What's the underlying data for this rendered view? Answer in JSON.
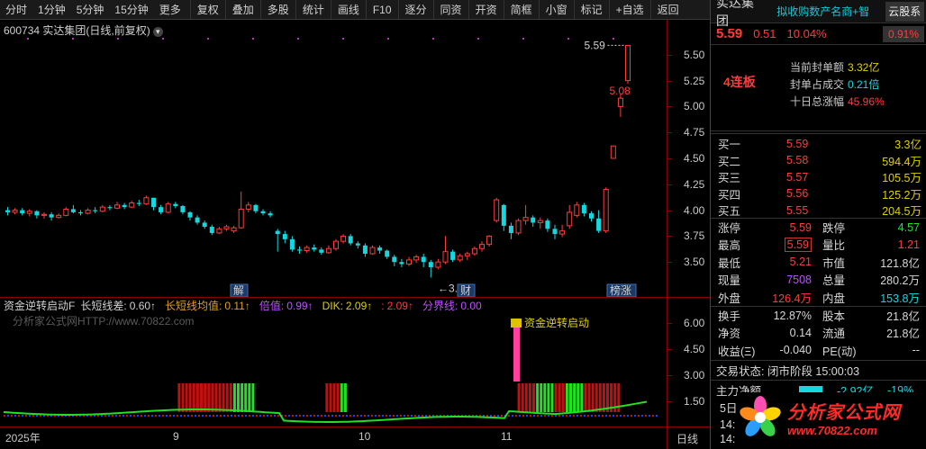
{
  "toolbar": {
    "periods": [
      "分时",
      "1分钟",
      "5分钟",
      "15分钟",
      "更多"
    ],
    "buttons": [
      "复权",
      "叠加",
      "多股",
      "统计",
      "画线",
      "F10",
      "逐分",
      "同资",
      "开资",
      "简框",
      "小窗",
      "标记",
      "+自选",
      "返回"
    ]
  },
  "chart": {
    "header": "600734 实达集团(日线,前复权)",
    "high_label": "5.59",
    "close_label": "5.08",
    "low_label": "←3.35",
    "marker_jie": "解",
    "marker_cai": "财",
    "marker_bangzhang": "榜涨",
    "price_ticks": [
      "5.50",
      "5.25",
      "5.00",
      "4.75",
      "4.50",
      "4.25",
      "4.00",
      "3.75",
      "3.50"
    ],
    "colors": {
      "up": "#ff3c3c",
      "down": "#14d8e0",
      "axis": "#8a0000"
    }
  },
  "chart_data": {
    "type": "candlestick",
    "ylim": [
      3.35,
      5.65
    ],
    "candles": [
      [
        4.0,
        3.98,
        4.03,
        3.95
      ],
      [
        3.98,
        4.0,
        4.02,
        3.96
      ],
      [
        4.0,
        3.97,
        4.02,
        3.95
      ],
      [
        3.97,
        3.99,
        4.01,
        3.94
      ],
      [
        3.99,
        3.95,
        4.0,
        3.92
      ],
      [
        3.95,
        3.96,
        3.98,
        3.92
      ],
      [
        3.96,
        3.93,
        3.98,
        3.9
      ],
      [
        3.93,
        3.95,
        3.97,
        3.92
      ],
      [
        3.95,
        4.01,
        4.03,
        3.94
      ],
      [
        4.01,
        3.98,
        4.05,
        3.97
      ],
      [
        3.98,
        3.97,
        4.0,
        3.95
      ],
      [
        3.97,
        4.0,
        4.02,
        3.96
      ],
      [
        4.0,
        3.99,
        4.03,
        3.97
      ],
      [
        3.99,
        4.03,
        4.05,
        3.98
      ],
      [
        4.03,
        4.02,
        4.05,
        4.0
      ],
      [
        4.02,
        4.05,
        4.08,
        4.01
      ],
      [
        4.05,
        4.03,
        4.07,
        4.01
      ],
      [
        4.03,
        4.07,
        4.09,
        4.02
      ],
      [
        4.07,
        4.06,
        4.1,
        4.04
      ],
      [
        4.06,
        4.12,
        4.14,
        4.05
      ],
      [
        4.12,
        4.03,
        4.12,
        4.0
      ],
      [
        4.03,
        3.98,
        4.05,
        3.96
      ],
      [
        3.98,
        4.06,
        4.08,
        3.97
      ],
      [
        4.06,
        4.04,
        4.08,
        4.02
      ],
      [
        4.04,
        3.98,
        4.05,
        3.96
      ],
      [
        3.98,
        3.93,
        3.99,
        3.9
      ],
      [
        3.93,
        3.88,
        3.95,
        3.86
      ],
      [
        3.88,
        3.84,
        3.9,
        3.82
      ],
      [
        3.84,
        3.78,
        3.86,
        3.76
      ],
      [
        3.78,
        3.82,
        3.84,
        3.77
      ],
      [
        3.82,
        3.84,
        3.86,
        3.8
      ],
      [
        3.8,
        3.83,
        3.85,
        3.78
      ],
      [
        3.83,
        4.01,
        4.18,
        3.82
      ],
      [
        4.01,
        4.05,
        4.08,
        3.98
      ],
      [
        4.05,
        3.99,
        4.06,
        3.97
      ],
      [
        3.99,
        3.97,
        4.01,
        3.95
      ],
      [
        3.97,
        3.95,
        3.99,
        3.93
      ],
      [
        3.8,
        3.77,
        3.82,
        3.6
      ],
      [
        3.77,
        3.72,
        3.8,
        3.68
      ],
      [
        3.72,
        3.62,
        3.75,
        3.6
      ],
      [
        3.62,
        3.61,
        3.65,
        3.58
      ],
      [
        3.61,
        3.64,
        3.66,
        3.59
      ],
      [
        3.64,
        3.62,
        3.67,
        3.6
      ],
      [
        3.62,
        3.59,
        3.64,
        3.57
      ],
      [
        3.59,
        3.63,
        3.66,
        3.58
      ],
      [
        3.63,
        3.7,
        3.72,
        3.61
      ],
      [
        3.7,
        3.75,
        3.77,
        3.68
      ],
      [
        3.75,
        3.68,
        3.77,
        3.66
      ],
      [
        3.68,
        3.66,
        3.7,
        3.63
      ],
      [
        3.66,
        3.58,
        3.68,
        3.55
      ],
      [
        3.58,
        3.64,
        3.66,
        3.57
      ],
      [
        3.64,
        3.61,
        3.66,
        3.58
      ],
      [
        3.61,
        3.55,
        3.62,
        3.53
      ],
      [
        3.55,
        3.5,
        3.57,
        3.46
      ],
      [
        3.5,
        3.48,
        3.53,
        3.45
      ],
      [
        3.48,
        3.52,
        3.55,
        3.46
      ],
      [
        3.52,
        3.55,
        3.57,
        3.49
      ],
      [
        3.55,
        3.5,
        3.58,
        3.45
      ],
      [
        3.5,
        3.45,
        3.52,
        3.35
      ],
      [
        3.45,
        3.5,
        3.53,
        3.43
      ],
      [
        3.5,
        3.6,
        3.75,
        3.48
      ],
      [
        3.6,
        3.52,
        3.62,
        3.5
      ],
      [
        3.52,
        3.56,
        3.58,
        3.5
      ],
      [
        3.56,
        3.58,
        3.6,
        3.52
      ],
      [
        3.58,
        3.63,
        3.65,
        3.56
      ],
      [
        3.63,
        3.67,
        3.7,
        3.6
      ],
      [
        3.67,
        3.75,
        3.76,
        3.65
      ],
      [
        3.9,
        4.1,
        4.12,
        3.88
      ],
      [
        4.05,
        3.85,
        4.06,
        3.8
      ],
      [
        3.85,
        3.78,
        3.88,
        3.72
      ],
      [
        3.78,
        3.9,
        3.92,
        3.76
      ],
      [
        3.9,
        3.93,
        4.05,
        3.86
      ],
      [
        3.93,
        3.88,
        3.95,
        3.84
      ],
      [
        3.88,
        3.9,
        3.93,
        3.82
      ],
      [
        3.9,
        3.82,
        3.92,
        3.79
      ],
      [
        3.82,
        3.77,
        3.86,
        3.72
      ],
      [
        3.77,
        3.8,
        3.86,
        3.74
      ],
      [
        3.85,
        3.98,
        4.05,
        3.82
      ],
      [
        3.95,
        4.05,
        4.08,
        3.93
      ],
      [
        4.05,
        3.97,
        4.07,
        3.94
      ],
      [
        3.97,
        3.92,
        3.99,
        3.89
      ],
      [
        3.92,
        3.8,
        4.0,
        3.78
      ],
      [
        3.8,
        4.2,
        4.22,
        3.78
      ],
      [
        4.5,
        4.62,
        4.62,
        4.5
      ],
      [
        5.0,
        5.08,
        5.12,
        4.9
      ],
      [
        5.25,
        5.59,
        5.59,
        5.22
      ]
    ],
    "ma_line": "down"
  },
  "indicator": {
    "title": "资金逆转启动F",
    "items": [
      {
        "label": "长短线差:",
        "value": "0.60↑"
      },
      {
        "label": "长短线均值:",
        "value": "0.11↑"
      },
      {
        "label": "倍值:",
        "value": "0.99↑"
      },
      {
        "label": "DIK:",
        "value": "2.09↑"
      },
      {
        "label": ":",
        "value": "2.09↑"
      },
      {
        "label": "分界线:",
        "value": "0.00"
      }
    ],
    "watermark": "分析家公式网HTTP://www.70822.com",
    "signal_text": "资金逆转启动",
    "axis_ticks": [
      "6.00",
      "4.50",
      "3.00",
      "1.50"
    ],
    "bar_pattern": [
      0,
      0,
      0,
      0,
      0,
      0,
      0,
      0,
      0,
      0,
      0,
      0,
      0,
      0,
      1,
      1,
      1,
      1,
      1,
      1,
      1,
      1,
      1,
      1,
      1,
      1,
      1,
      1,
      1,
      2,
      2,
      2,
      2,
      2,
      2,
      0,
      0,
      0,
      0,
      0,
      0,
      0,
      0,
      0,
      0,
      0,
      0,
      0,
      0,
      0,
      0,
      0,
      0,
      0,
      1,
      1,
      1,
      1,
      2,
      2,
      0,
      0,
      0,
      0,
      0,
      0,
      0,
      0,
      0,
      0,
      0,
      0,
      0,
      0,
      0,
      0,
      0,
      0,
      0,
      0,
      0,
      0,
      0,
      0,
      0,
      0,
      0,
      0,
      0,
      0,
      0,
      0,
      0,
      0,
      0,
      0,
      0,
      0,
      0,
      0,
      0,
      0,
      0,
      0,
      0,
      0,
      1,
      1,
      1,
      1,
      1,
      2,
      2,
      2,
      2,
      2,
      1,
      1,
      1,
      2,
      2,
      2,
      2,
      2,
      1,
      1,
      1,
      1,
      1,
      1,
      1,
      1,
      1,
      1
    ]
  },
  "date_axis": {
    "labels": [
      "2025年",
      "9",
      "10",
      "11"
    ],
    "period_label": "日线"
  },
  "panel": {
    "name": "实达集团",
    "concept": "拟收购数产名商+智",
    "cloud": "云股系",
    "price": "5.59",
    "change": "0.51",
    "pct": "10.04%",
    "pct2": "0.91%",
    "lian": "4连板",
    "seal": [
      {
        "k": "当前封单额",
        "v": "3.32亿",
        "cls": "yellow"
      },
      {
        "k": "封单占成交",
        "v": "0.21倍",
        "cls": "cyan"
      },
      {
        "k": "十日总涨幅",
        "v": "45.96%",
        "cls": "red"
      }
    ],
    "orderbook": [
      {
        "label": "买一",
        "price": "5.59",
        "vol": "3.3亿"
      },
      {
        "label": "买二",
        "price": "5.58",
        "vol": "594.4万"
      },
      {
        "label": "买三",
        "price": "5.57",
        "vol": "105.5万"
      },
      {
        "label": "买四",
        "price": "5.56",
        "vol": "125.2万"
      },
      {
        "label": "买五",
        "price": "5.55",
        "vol": "204.5万"
      }
    ],
    "stats": [
      {
        "k1": "涨停",
        "v1": "5.59",
        "c1": "red",
        "k2": "跌停",
        "v2": "4.57",
        "c2": "green"
      },
      {
        "k1": "最高",
        "v1": "5.59",
        "c1": "red boxed",
        "k2": "量比",
        "v2": "1.21",
        "c2": "red"
      },
      {
        "k1": "最低",
        "v1": "5.21",
        "c1": "red",
        "k2": "市值",
        "v2": "121.8亿",
        "c2": "white"
      },
      {
        "k1": "现量",
        "v1": "7508",
        "c1": "purple",
        "k2": "总量",
        "v2": "280.2万",
        "c2": "white"
      },
      {
        "k1": "外盘",
        "v1": "126.4万",
        "c1": "red",
        "k2": "内盘",
        "v2": "153.8万",
        "c2": "cyan"
      }
    ],
    "stats2": [
      {
        "k1": "换手",
        "v1": "12.87%",
        "k2": "股本",
        "v2": "21.8亿"
      },
      {
        "k1": "净资",
        "v1": "0.14",
        "k2": "流通",
        "v2": "21.8亿"
      },
      {
        "k1": "收益(Ξ)",
        "v1": "-0.040",
        "k2": "PE(动)",
        "v2": "--"
      }
    ],
    "trade_state": "交易状态: 闭市阶段 15:00:03",
    "main_flow_label": "主力净额",
    "main_flow_value": "-2.92亿",
    "main_flow_pct": "-19%",
    "flow_row2": "5日",
    "flow_row3": "14:",
    "flow_row4": "14:",
    "logo_text": "分析家公式网",
    "logo_url": "www.70822.com"
  }
}
